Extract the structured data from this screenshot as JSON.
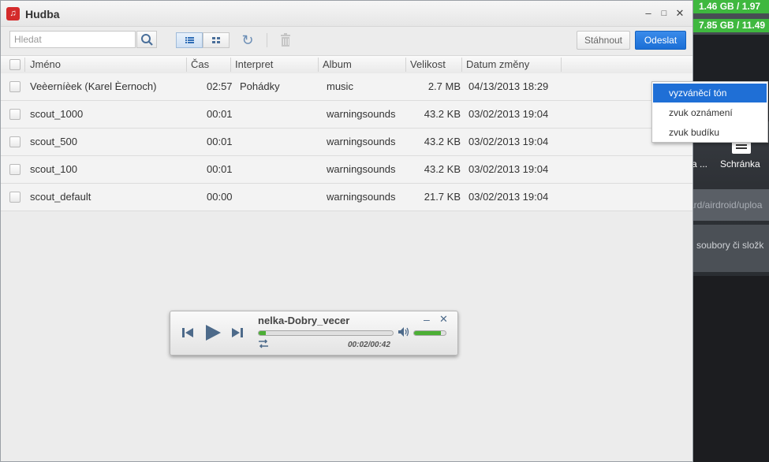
{
  "desktop": {
    "stat1": "1.46 GB / 1.97",
    "stat2": "7.85 GB / 11.49",
    "tile_label_partial": "a ...",
    "tile_label": "Schránka",
    "upload_path": "ard/airdroid/uploa",
    "drop_hint": "soubory či složk"
  },
  "window": {
    "title": "Hudba",
    "minimize": "–",
    "maximize": "□",
    "close": "✕"
  },
  "toolbar": {
    "search_placeholder": "Hledat",
    "download_label": "Stáhnout",
    "send_label": "Odeslat"
  },
  "columns": [
    "Jméno",
    "Čas",
    "Interpret",
    "Album",
    "Velikost",
    "Datum změny"
  ],
  "rows": [
    {
      "name": "Veèerníèek (Karel Èernoch)",
      "time": "02:57",
      "artist": "Pohádky",
      "album": "music",
      "size": "2.7 MB",
      "date": "04/13/2013 18:29"
    },
    {
      "name": "scout_1000",
      "time": "00:01",
      "artist": "",
      "album": "warningsounds",
      "size": "43.2 KB",
      "date": "03/02/2013 19:04"
    },
    {
      "name": "scout_500",
      "time": "00:01",
      "artist": "",
      "album": "warningsounds",
      "size": "43.2 KB",
      "date": "03/02/2013 19:04"
    },
    {
      "name": "scout_100",
      "time": "00:01",
      "artist": "",
      "album": "warningsounds",
      "size": "43.2 KB",
      "date": "03/02/2013 19:04"
    },
    {
      "name": "scout_default",
      "time": "00:00",
      "artist": "",
      "album": "warningsounds",
      "size": "21.7 KB",
      "date": "03/02/2013 19:04"
    }
  ],
  "context_menu": {
    "items": [
      "vyzváněcí tón",
      "zvuk oznámení",
      "zvuk budíku"
    ],
    "selected_index": 0
  },
  "player": {
    "track": "nelka-Dobry_vecer",
    "time_display": "00:02/00:42",
    "progress_fraction": 0.05,
    "volume_fraction": 0.85,
    "accent_color": "#4caf35"
  },
  "colors": {
    "primary_button": "#1b6fd6",
    "menu_highlight": "#1f6fd6",
    "status_green": "#3fb83f"
  }
}
